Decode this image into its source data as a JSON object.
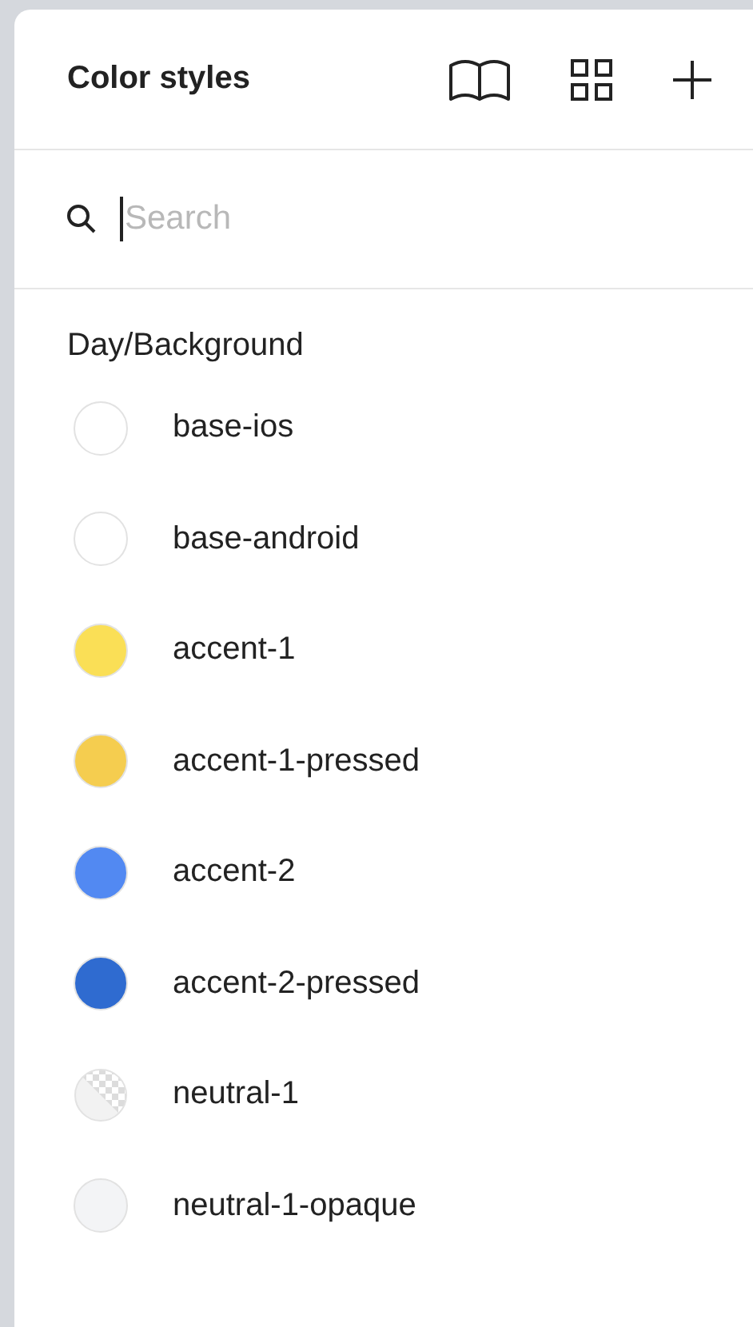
{
  "panel": {
    "title": "Color styles"
  },
  "search": {
    "placeholder": "Search",
    "focused": true
  },
  "groups": [
    {
      "label": "Day/Background",
      "styles": [
        {
          "name": "base-ios",
          "kind": "solid",
          "color": "#ffffff"
        },
        {
          "name": "base-android",
          "kind": "solid",
          "color": "#ffffff"
        },
        {
          "name": "accent-1",
          "kind": "solid",
          "color": "#fadf56"
        },
        {
          "name": "accent-1-pressed",
          "kind": "solid",
          "color": "#f5cd4f"
        },
        {
          "name": "accent-2",
          "kind": "solid",
          "color": "#5289f2"
        },
        {
          "name": "accent-2-pressed",
          "kind": "solid",
          "color": "#2f6bd0"
        },
        {
          "name": "neutral-1",
          "kind": "translucent",
          "color": "#f2f2f2"
        },
        {
          "name": "neutral-1-opaque",
          "kind": "solid",
          "color": "#f3f4f6"
        }
      ]
    }
  ]
}
